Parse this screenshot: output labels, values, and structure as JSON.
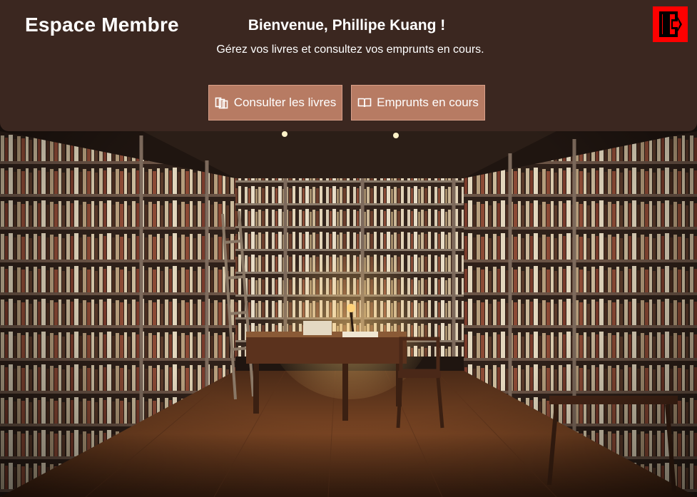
{
  "header": {
    "brand": "Espace Membre",
    "welcome": "Bienvenue, Phillipe Kuang !",
    "subtitle": "Gérez vos livres et consultez vos emprunts en cours.",
    "logout_icon": "door-exit-icon"
  },
  "actions": {
    "books_label": "Consulter les livres",
    "books_icon": "books-icon",
    "loans_label": "Emprunts en cours",
    "loans_icon": "open-book-icon"
  },
  "background": {
    "scene": "library-room-image"
  },
  "colors": {
    "header_bg": "#3b2720",
    "button_bg": "#b77b63",
    "logout_bg": "#ff0000",
    "text": "#ffffff"
  }
}
